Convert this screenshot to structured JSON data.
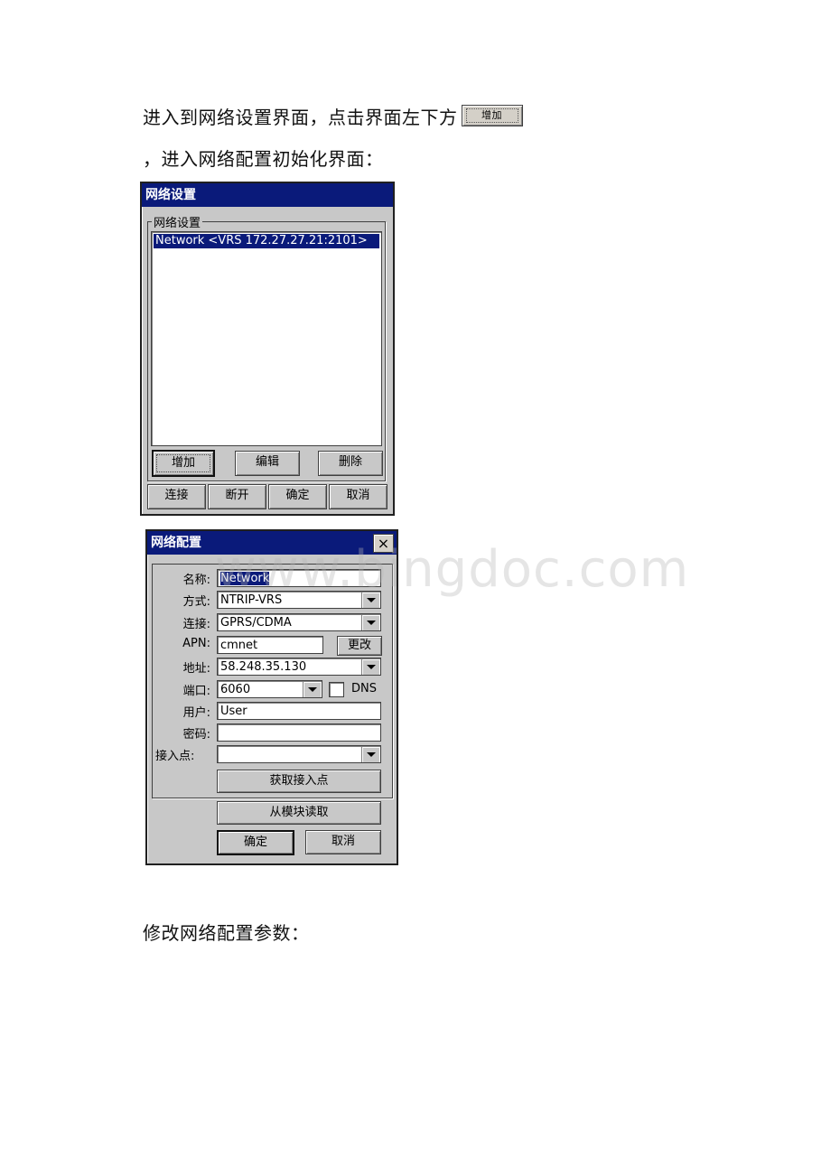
{
  "paragraphs": {
    "p1_before": "进入到网络设置界面，点击界面左下方",
    "p1_inline_button": "增加",
    "p2": "，进入网络配置初始化界面：",
    "p3": "修改网络配置参数："
  },
  "dialog1": {
    "title": "网络设置",
    "group_label": "网络设置",
    "list_items": [
      "Network <VRS  172.27.27.21:2101>"
    ],
    "selected_index": 0,
    "buttons_row1": [
      "增加",
      "编辑",
      "删除"
    ],
    "buttons_row2": [
      "连接",
      "断开",
      "确定",
      "取消"
    ]
  },
  "dialog2": {
    "title": "网络配置",
    "close_icon": "×",
    "fields": {
      "name": {
        "label": "名称:",
        "value": "Network"
      },
      "mode": {
        "label": "方式:",
        "value": "NTRIP-VRS"
      },
      "connection": {
        "label": "连接:",
        "value": "GPRS/CDMA"
      },
      "apn": {
        "label": "APN:",
        "value": "cmnet",
        "button": "更改"
      },
      "address": {
        "label": "地址:",
        "value": "58.248.35.130"
      },
      "port": {
        "label": "端口:",
        "value": "6060",
        "dns_label": "DNS",
        "dns_checked": false
      },
      "user": {
        "label": "用户:",
        "value": "User"
      },
      "password": {
        "label": "密码:",
        "value": ""
      },
      "mountpoint": {
        "label": "接入点:",
        "value": ""
      }
    },
    "get_mountpoint_button": "获取接入点",
    "read_module_button": "从模块读取",
    "ok_button": "确定",
    "cancel_button": "取消"
  },
  "watermark": "www.bingdoc.com"
}
